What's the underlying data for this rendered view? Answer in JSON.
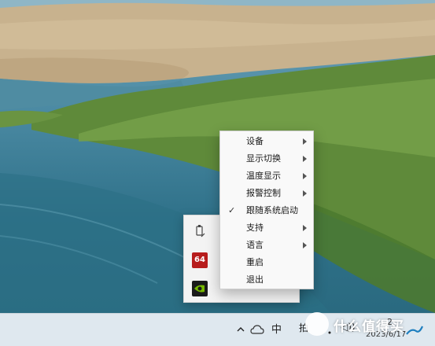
{
  "menu": {
    "items": [
      {
        "label": "设备",
        "submenu": true,
        "checked": false
      },
      {
        "label": "显示切换",
        "submenu": true,
        "checked": false
      },
      {
        "label": "温度显示",
        "submenu": true,
        "checked": false
      },
      {
        "label": "报警控制",
        "submenu": true,
        "checked": false
      },
      {
        "label": "跟随系统启动",
        "submenu": false,
        "checked": true
      },
      {
        "label": "支持",
        "submenu": true,
        "checked": false
      },
      {
        "label": "语言",
        "submenu": true,
        "checked": false
      },
      {
        "label": "重启",
        "submenu": false,
        "checked": false
      },
      {
        "label": "退出",
        "submenu": false,
        "checked": false
      }
    ],
    "check_glyph": "✓"
  },
  "tray_flyout": {
    "icons": [
      "usb-device-icon",
      "aida64-icon",
      "nvidia-icon"
    ],
    "aida_label": "64"
  },
  "taskbar": {
    "ime": "中",
    "partial_text": "拍",
    "volume": "◁))",
    "date": "2023/6/17",
    "time_fragment": "2"
  },
  "watermark": {
    "text": "什么值得买"
  },
  "colors": {
    "menu_bg": "#f9f9f9",
    "taskbar_bg": "#dfe8ef",
    "aida_red": "#b71c1c",
    "nvidia_green": "#76b900"
  }
}
